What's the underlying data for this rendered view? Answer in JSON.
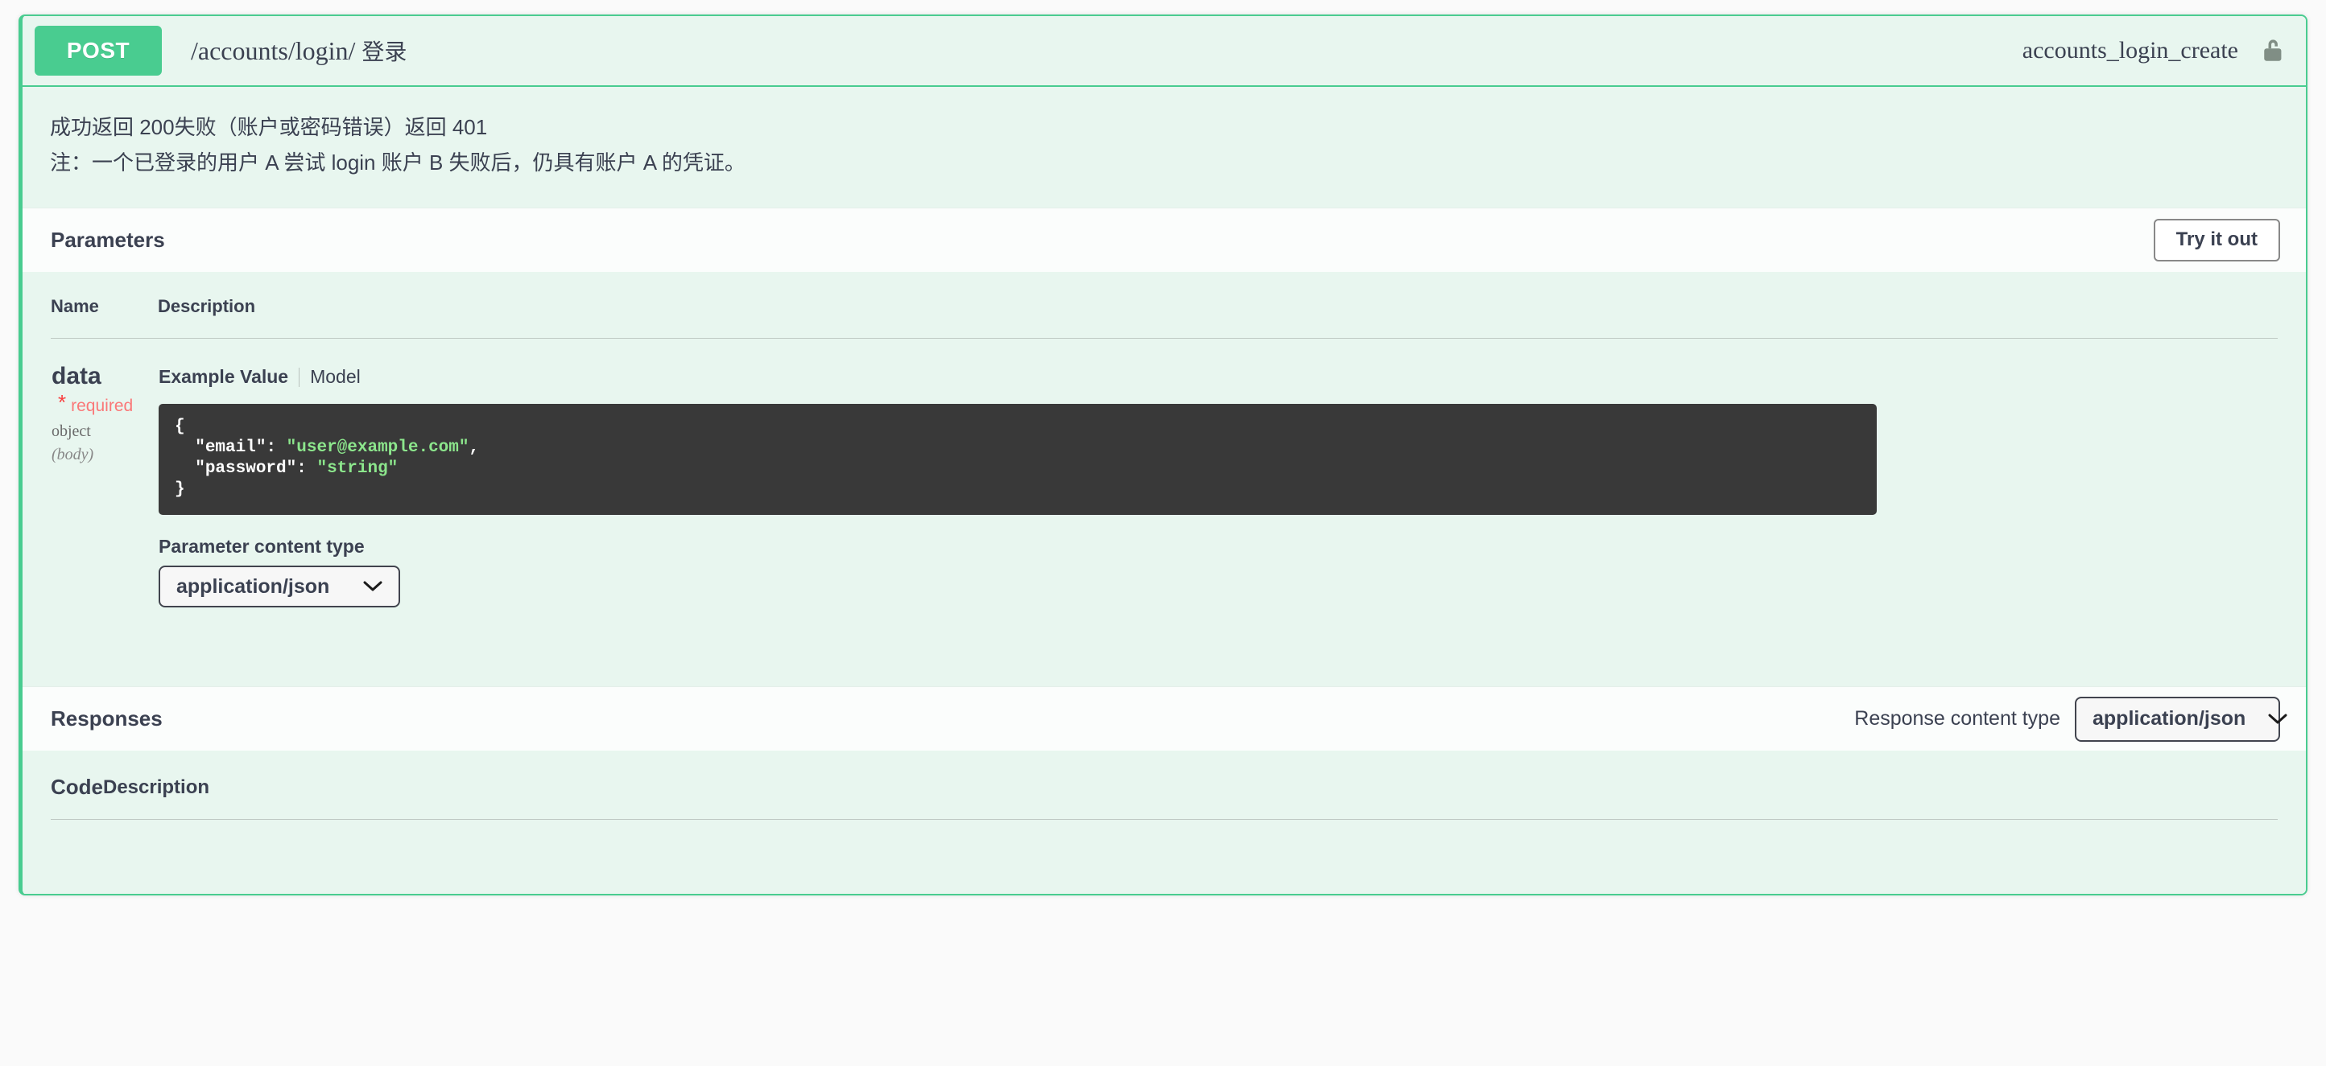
{
  "operation": {
    "method": "POST",
    "path": "/accounts/login/",
    "summary": "登录",
    "operation_id": "accounts_login_create",
    "lock_icon": "unlocked-padlock-icon",
    "accent_color": "#49cc90",
    "panel_background": "#e8f6ef",
    "description_lines": [
      "成功返回 200失败（账户或密码错误）返回 401",
      "注：一个已登录的用户 A 尝试 login 账户 B 失败后，仍具有账户 A 的凭证。"
    ]
  },
  "parameters": {
    "title": "Parameters",
    "try_it_out_label": "Try it out",
    "columns": {
      "name": "Name",
      "description": "Description"
    },
    "rows": [
      {
        "name": "data",
        "required_star": "*",
        "required_label": "required",
        "type": "object",
        "location": "(body)",
        "example_tab_label": "Example Value",
        "model_tab_label": "Model",
        "example_value": {
          "open_brace": "{",
          "lines": [
            {
              "key": "\"email\"",
              "colon": ": ",
              "value": "\"user@example.com\"",
              "comma": ","
            },
            {
              "key": "\"password\"",
              "colon": ": ",
              "value": "\"string\"",
              "comma": ""
            }
          ],
          "close_brace": "}"
        },
        "content_type": {
          "label": "Parameter content type",
          "selected": "application/json",
          "chevron_icon": "chevron-down-icon"
        }
      }
    ]
  },
  "responses": {
    "title": "Responses",
    "content_type": {
      "label": "Response content type",
      "selected": "application/json",
      "chevron_icon": "chevron-down-icon"
    },
    "columns": {
      "code": "Code",
      "description": "Description"
    },
    "rows": []
  }
}
